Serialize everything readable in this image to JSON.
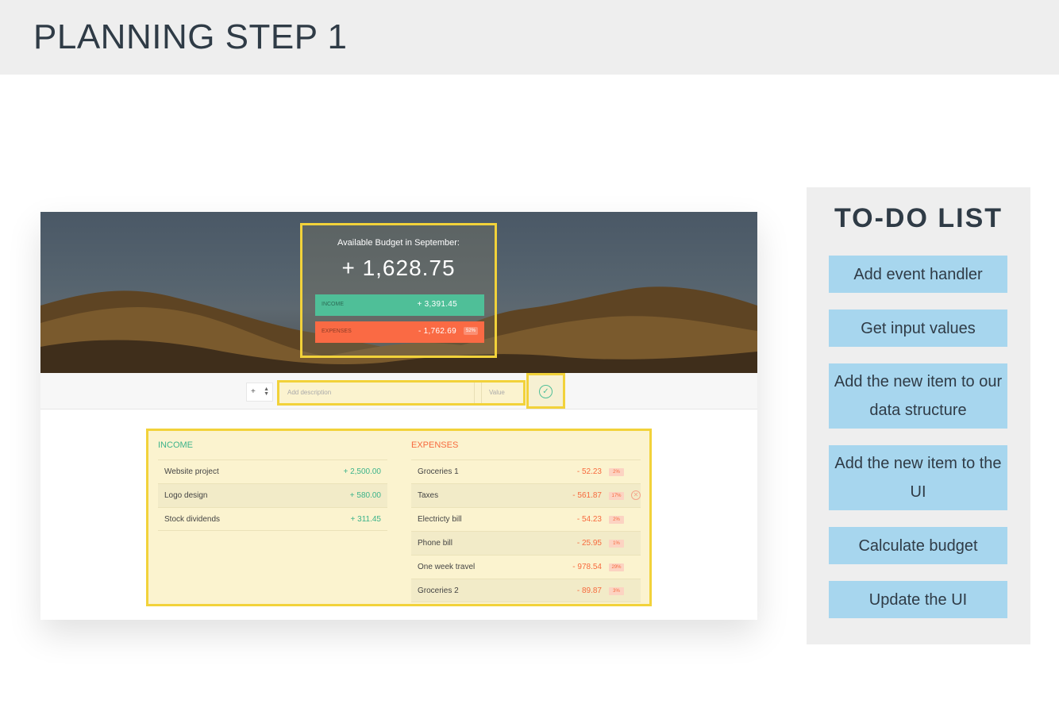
{
  "page_title": "PLANNING STEP 1",
  "app": {
    "budget_title": "Available Budget in September:",
    "budget_value": "+ 1,628.75",
    "income_label": "INCOME",
    "income_value": "+ 3,391.45",
    "expenses_label": "EXPENSES",
    "expenses_value": "- 1,762.69",
    "expenses_pct": "52%",
    "type_value": "+",
    "desc_placeholder": "Add description",
    "value_placeholder": "Value",
    "income_list_title": "INCOME",
    "expenses_list_title": "EXPENSES",
    "income_items": [
      {
        "desc": "Website project",
        "amount": "+ 2,500.00"
      },
      {
        "desc": "Logo design",
        "amount": "+ 580.00"
      },
      {
        "desc": "Stock dividends",
        "amount": "+ 311.45"
      }
    ],
    "expense_items": [
      {
        "desc": "Groceries 1",
        "amount": "- 52.23",
        "pct": "2%"
      },
      {
        "desc": "Taxes",
        "amount": "- 561.87",
        "pct": "17%"
      },
      {
        "desc": "Electricty bill",
        "amount": "- 54.23",
        "pct": "2%"
      },
      {
        "desc": "Phone bill",
        "amount": "- 25.95",
        "pct": "1%"
      },
      {
        "desc": "One week travel",
        "amount": "- 978.54",
        "pct": "29%"
      },
      {
        "desc": "Groceries 2",
        "amount": "- 89.87",
        "pct": "3%"
      }
    ]
  },
  "todo": {
    "title": "TO-DO LIST",
    "items": [
      "Add event handler",
      "Get input values",
      "Add the new item to our data structure",
      "Add the new item to the UI",
      "Calculate budget",
      "Update the UI"
    ]
  },
  "colors": {
    "income": "#4fbf98",
    "expenses": "#fa6a44",
    "highlight": "#f2d23a",
    "todo_item": "#a7d6ee"
  }
}
